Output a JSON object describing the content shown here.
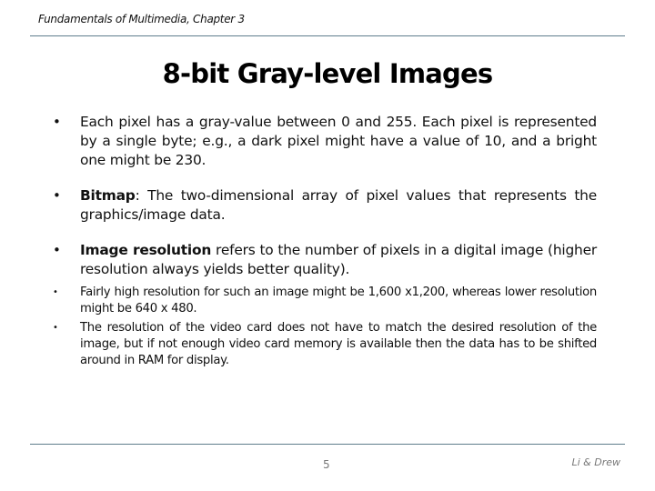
{
  "header": {
    "course": "Fundamentals of Multimedia, Chapter 3"
  },
  "slide": {
    "title": "8-bit Gray-level Images",
    "bullets": [
      {
        "bold": "",
        "text": "Each pixel has a gray-value between 0 and 255. Each pixel is represented by a single byte; e.g., a dark pixel might have a value of 10, and a bright one might be 230."
      },
      {
        "bold": "Bitmap",
        "text": ": The two-dimensional array of pixel values that represents the graphics/image data."
      },
      {
        "bold": "Image resolution",
        "text": " refers to the number of pixels in a digital image (higher resolution always yields better quality)."
      }
    ],
    "sub_bullets": [
      "Fairly high resolution for such an image might be 1,600 x1,200, whereas lower resolution might be 640 x 480.",
      "The resolution of the video card does not have to match the desired resolution of the image, but if not enough video card memory is available then the data has to be shifted around in RAM for display."
    ],
    "bullet_glyph": "•"
  },
  "footer": {
    "page_number": "5",
    "authors": "Li & Drew"
  }
}
